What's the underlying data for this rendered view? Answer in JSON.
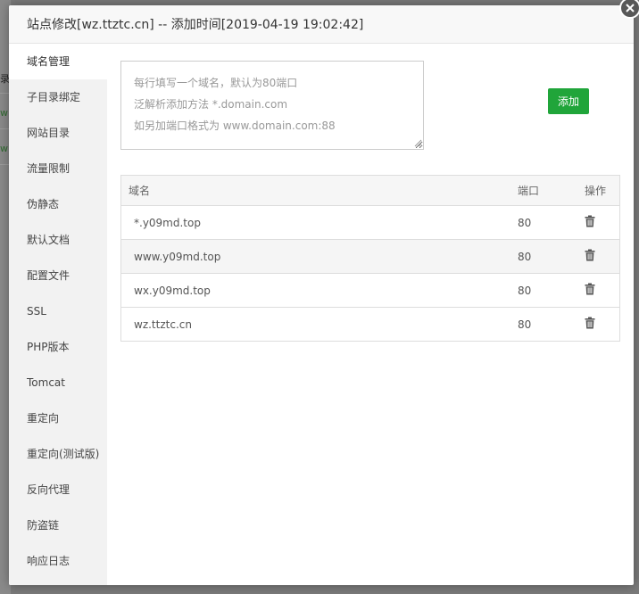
{
  "dialog": {
    "title": "站点修改[wz.ttztc.cn] -- 添加时间[2019-04-19 19:02:42]"
  },
  "sidebar": {
    "items": [
      {
        "label": "域名管理"
      },
      {
        "label": "子目录绑定"
      },
      {
        "label": "网站目录"
      },
      {
        "label": "流量限制"
      },
      {
        "label": "伪静态"
      },
      {
        "label": "默认文档"
      },
      {
        "label": "配置文件"
      },
      {
        "label": "SSL"
      },
      {
        "label": "PHP版本"
      },
      {
        "label": "Tomcat"
      },
      {
        "label": "重定向"
      },
      {
        "label": "重定向(测试版)"
      },
      {
        "label": "反向代理"
      },
      {
        "label": "防盗链"
      },
      {
        "label": "响应日志"
      }
    ],
    "active_index": 0
  },
  "domain_form": {
    "placeholder_lines": [
      "每行填写一个域名，默认为80端口",
      "泛解析添加方法 *.domain.com",
      "如另加端口格式为 www.domain.com:88"
    ],
    "add_label": "添加"
  },
  "domain_table": {
    "headers": {
      "domain": "域名",
      "port": "端口",
      "action": "操作"
    },
    "rows": [
      {
        "domain": "*.y09md.top",
        "port": "80"
      },
      {
        "domain": "www.y09md.top",
        "port": "80"
      },
      {
        "domain": "wx.y09md.top",
        "port": "80"
      },
      {
        "domain": "wz.ttztc.cn",
        "port": "80"
      }
    ],
    "delete_icon": "trash-icon"
  },
  "colors": {
    "accent_green": "#20a53a",
    "sidebar_bg": "#f2f2f2",
    "overlay": "#7a7a7a"
  }
}
